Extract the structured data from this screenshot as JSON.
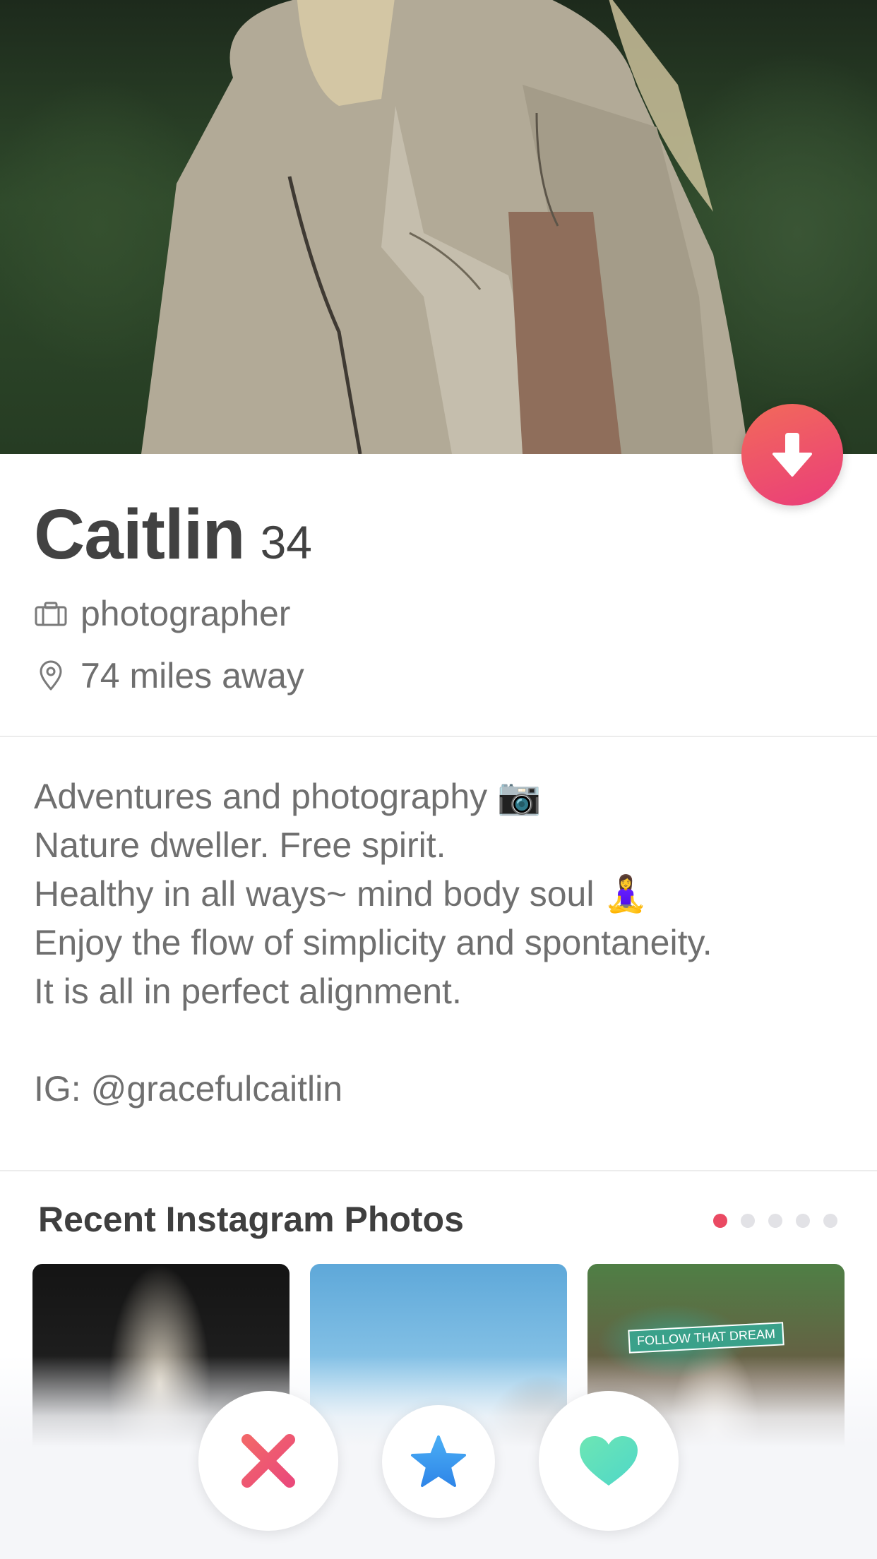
{
  "profile": {
    "name": "Caitlin",
    "age": "34",
    "job": "photographer",
    "distance": "74 miles away"
  },
  "bio": {
    "lines": [
      "Adventures and photography 📷",
      "Nature dweller. Free spirit.",
      "Healthy in all ways~ mind body soul 🧘‍♀️",
      "Enjoy the flow of simplicity and spontaneity.",
      "It is all in perfect alignment."
    ],
    "instagram": "IG: @gracefulcaitlin"
  },
  "instagram": {
    "header": "Recent Instagram Photos",
    "page_count": 5,
    "active_page": 1,
    "thumb3_sign": "FOLLOW THAT DREAM"
  },
  "icons": {
    "profile_toggle": "arrow-down-icon",
    "job": "briefcase-icon",
    "distance": "location-pin-icon",
    "nope": "x-icon",
    "super_like": "star-icon",
    "like": "heart-icon"
  },
  "colors": {
    "accent": "#ea4a63",
    "nope": "#ef5a6a",
    "super_like": "#3d9df2",
    "like": "#5fe3bd"
  }
}
